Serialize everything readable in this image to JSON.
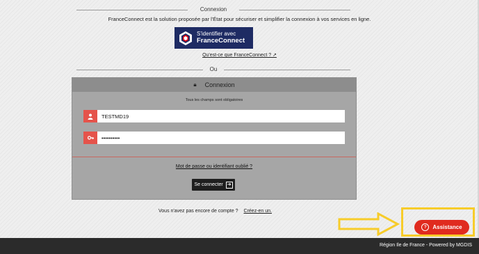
{
  "header": {
    "connexion_label": "Connexion",
    "intro": "FranceConnect est la solution proposée par l'État pour sécuriser et simplifier la connexion à vos services en ligne.",
    "fc_button_line1": "S'identifier avec",
    "fc_button_line2": "FranceConnect",
    "fc_link": "Qu'est-ce que FranceConnect ? ↗",
    "ou_label": "Ou"
  },
  "login": {
    "title": "Connexion",
    "required_note": "Tous les champs sont obligatoires",
    "username_value": "TESTMD19",
    "password_value": "••••••••••",
    "forgot_link": "Mot de passe ou identifiant oublié ?",
    "submit_label": "Se connecter"
  },
  "signup": {
    "text": "Vous n'avez pas encore de compte ?",
    "link": "Créez-en un."
  },
  "assistance": {
    "label": "Assistance"
  },
  "footer": {
    "text": "Région Ile de France - Powered by MGDIS"
  },
  "colors": {
    "accent_red": "#e02b1f",
    "fc_blue": "#1e2b63",
    "annotation_yellow": "#f7cc2a"
  }
}
